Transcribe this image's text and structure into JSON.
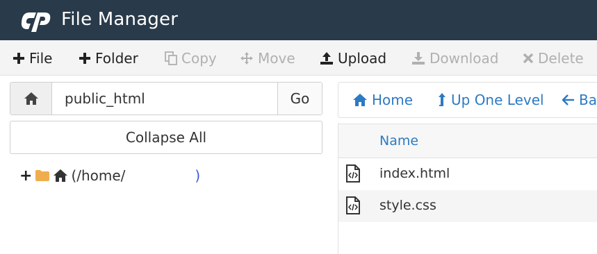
{
  "header": {
    "app_title": "File Manager",
    "logo_icon": "cpanel-logo-icon",
    "background": "#293a4a"
  },
  "toolbar": {
    "items": [
      {
        "label": "File",
        "icon": "plus-icon",
        "enabled": true
      },
      {
        "label": "Folder",
        "icon": "plus-icon",
        "enabled": true
      },
      {
        "label": "Copy",
        "icon": "copy-icon",
        "enabled": false
      },
      {
        "label": "Move",
        "icon": "move-icon",
        "enabled": false
      },
      {
        "label": "Upload",
        "icon": "upload-icon",
        "enabled": true
      },
      {
        "label": "Download",
        "icon": "download-icon",
        "enabled": false
      },
      {
        "label": "Delete",
        "icon": "close-icon",
        "enabled": false
      }
    ]
  },
  "left": {
    "path_value": "public_html",
    "go_label": "Go",
    "collapse_label": "Collapse All",
    "tree": {
      "root_label": "(/home/",
      "root_label_end": ")"
    }
  },
  "right": {
    "nav": {
      "home_label": "Home",
      "up_label": "Up One Level",
      "back_label": "Ba"
    },
    "columns": {
      "name": "Name"
    },
    "files": [
      {
        "name": "index.html",
        "icon": "code-file-icon"
      },
      {
        "name": "style.css",
        "icon": "code-file-icon"
      }
    ]
  },
  "colors": {
    "link": "#2c7ac3",
    "disabled": "#b0b0b0",
    "folder": "#f0ad4e"
  }
}
